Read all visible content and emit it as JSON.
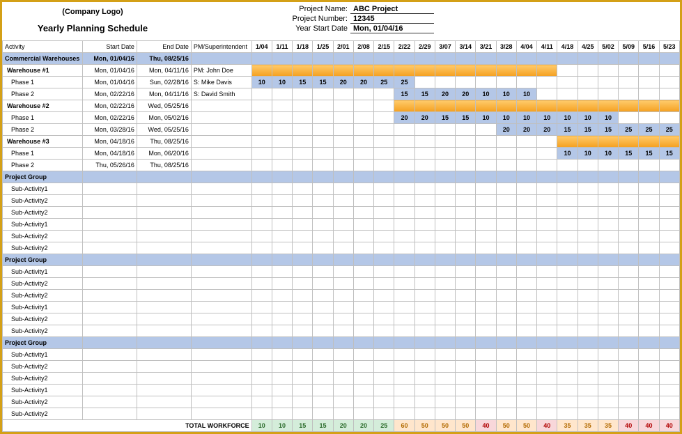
{
  "header": {
    "company_logo": "(Company Logo)",
    "title": "Yearly Planning Schedule",
    "meta": [
      {
        "label": "Project Name:",
        "value": "ABC Project"
      },
      {
        "label": "Project Number:",
        "value": "12345"
      },
      {
        "label": "Year Start Date",
        "value": "Mon, 01/04/16"
      }
    ]
  },
  "columns": {
    "activity": "Activity",
    "start": "Start Date",
    "end": "End Date",
    "pm": "PM/Superintendent"
  },
  "weeks": [
    "1/04",
    "1/11",
    "1/18",
    "1/25",
    "2/01",
    "2/08",
    "2/15",
    "2/22",
    "2/29",
    "3/07",
    "3/14",
    "3/21",
    "3/28",
    "4/04",
    "4/11",
    "4/18",
    "4/25",
    "5/02",
    "5/09",
    "5/16",
    "5/23"
  ],
  "rows": [
    {
      "type": "group",
      "activity": "Commercial Warehouses",
      "start": "Mon, 01/04/16",
      "end": "Thu, 08/25/16",
      "pm": "",
      "bar": {
        "style": "red",
        "from": 0,
        "to": 20
      }
    },
    {
      "type": "sub1",
      "activity": "Warehouse #1",
      "start": "Mon, 01/04/16",
      "end": "Mon, 04/11/16",
      "pm": "PM: John Doe",
      "bar": {
        "style": "orange",
        "from": 0,
        "to": 14
      }
    },
    {
      "type": "sub2",
      "activity": "Phase 1",
      "start": "Mon, 01/04/16",
      "end": "Sun, 02/28/16",
      "pm": "S: Mike Davis",
      "cells": {
        "0": "10",
        "1": "10",
        "2": "15",
        "3": "15",
        "4": "20",
        "5": "20",
        "6": "25",
        "7": "25"
      }
    },
    {
      "type": "sub2",
      "activity": "Phase 2",
      "start": "Mon, 02/22/16",
      "end": "Mon, 04/11/16",
      "pm": "S: David Smith",
      "cells": {
        "7": "15",
        "8": "15",
        "9": "20",
        "10": "20",
        "11": "10",
        "12": "10",
        "13": "10"
      }
    },
    {
      "type": "sub1",
      "activity": "Warehouse #2",
      "start": "Mon, 02/22/16",
      "end": "Wed, 05/25/16",
      "pm": "",
      "bar": {
        "style": "orange",
        "from": 7,
        "to": 20
      }
    },
    {
      "type": "sub2",
      "activity": "Phase 1",
      "start": "Mon, 02/22/16",
      "end": "Mon, 05/02/16",
      "pm": "",
      "cells": {
        "7": "20",
        "8": "20",
        "9": "15",
        "10": "15",
        "11": "10",
        "12": "10",
        "13": "10",
        "14": "10",
        "15": "10",
        "16": "10",
        "17": "10"
      }
    },
    {
      "type": "sub2",
      "activity": "Phase 2",
      "start": "Mon, 03/28/16",
      "end": "Wed, 05/25/16",
      "pm": "",
      "cells": {
        "12": "20",
        "13": "20",
        "14": "20",
        "15": "15",
        "16": "15",
        "17": "15",
        "18": "25",
        "19": "25",
        "20": "25"
      }
    },
    {
      "type": "sub1",
      "activity": "Warehouse #3",
      "start": "Mon, 04/18/16",
      "end": "Thu, 08/25/16",
      "pm": "",
      "bar": {
        "style": "orange",
        "from": 15,
        "to": 20
      }
    },
    {
      "type": "sub2",
      "activity": "Phase 1",
      "start": "Mon, 04/18/16",
      "end": "Mon, 06/20/16",
      "pm": "",
      "cells": {
        "15": "10",
        "16": "10",
        "17": "10",
        "18": "15",
        "19": "15",
        "20": "15"
      }
    },
    {
      "type": "sub2",
      "activity": "Phase 2",
      "start": "Thu, 05/26/16",
      "end": "Thu, 08/25/16",
      "pm": "",
      "cells": {}
    },
    {
      "type": "group",
      "activity": "Project Group",
      "start": "",
      "end": "",
      "pm": ""
    },
    {
      "type": "sub2",
      "activity": "Sub-Activity1",
      "start": "",
      "end": "",
      "pm": ""
    },
    {
      "type": "sub2",
      "activity": "Sub-Activity2",
      "start": "",
      "end": "",
      "pm": ""
    },
    {
      "type": "sub2",
      "activity": "Sub-Activity2",
      "start": "",
      "end": "",
      "pm": ""
    },
    {
      "type": "sub2",
      "activity": "Sub-Activity1",
      "start": "",
      "end": "",
      "pm": ""
    },
    {
      "type": "sub2",
      "activity": "Sub-Activity2",
      "start": "",
      "end": "",
      "pm": ""
    },
    {
      "type": "sub2",
      "activity": "Sub-Activity2",
      "start": "",
      "end": "",
      "pm": ""
    },
    {
      "type": "group",
      "activity": "Project Group",
      "start": "",
      "end": "",
      "pm": ""
    },
    {
      "type": "sub2",
      "activity": "Sub-Activity1",
      "start": "",
      "end": "",
      "pm": ""
    },
    {
      "type": "sub2",
      "activity": "Sub-Activity2",
      "start": "",
      "end": "",
      "pm": ""
    },
    {
      "type": "sub2",
      "activity": "Sub-Activity2",
      "start": "",
      "end": "",
      "pm": ""
    },
    {
      "type": "sub2",
      "activity": "Sub-Activity1",
      "start": "",
      "end": "",
      "pm": ""
    },
    {
      "type": "sub2",
      "activity": "Sub-Activity2",
      "start": "",
      "end": "",
      "pm": ""
    },
    {
      "type": "sub2",
      "activity": "Sub-Activity2",
      "start": "",
      "end": "",
      "pm": ""
    },
    {
      "type": "group",
      "activity": "Project Group",
      "start": "",
      "end": "",
      "pm": ""
    },
    {
      "type": "sub2",
      "activity": "Sub-Activity1",
      "start": "",
      "end": "",
      "pm": ""
    },
    {
      "type": "sub2",
      "activity": "Sub-Activity2",
      "start": "",
      "end": "",
      "pm": ""
    },
    {
      "type": "sub2",
      "activity": "Sub-Activity2",
      "start": "",
      "end": "",
      "pm": ""
    },
    {
      "type": "sub2",
      "activity": "Sub-Activity1",
      "start": "",
      "end": "",
      "pm": ""
    },
    {
      "type": "sub2",
      "activity": "Sub-Activity2",
      "start": "",
      "end": "",
      "pm": ""
    },
    {
      "type": "sub2",
      "activity": "Sub-Activity2",
      "start": "",
      "end": "",
      "pm": ""
    }
  ],
  "totals": {
    "label": "TOTAL WORKFORCE",
    "values": [
      {
        "v": "10",
        "c": "tg"
      },
      {
        "v": "10",
        "c": "tg"
      },
      {
        "v": "15",
        "c": "tg"
      },
      {
        "v": "15",
        "c": "tg"
      },
      {
        "v": "20",
        "c": "tg"
      },
      {
        "v": "20",
        "c": "tg"
      },
      {
        "v": "25",
        "c": "tg"
      },
      {
        "v": "60",
        "c": "to"
      },
      {
        "v": "50",
        "c": "to"
      },
      {
        "v": "50",
        "c": "to"
      },
      {
        "v": "50",
        "c": "to"
      },
      {
        "v": "40",
        "c": "tr"
      },
      {
        "v": "50",
        "c": "to"
      },
      {
        "v": "50",
        "c": "to"
      },
      {
        "v": "40",
        "c": "tr"
      },
      {
        "v": "35",
        "c": "to"
      },
      {
        "v": "35",
        "c": "to"
      },
      {
        "v": "35",
        "c": "to"
      },
      {
        "v": "40",
        "c": "tr"
      },
      {
        "v": "40",
        "c": "tr"
      },
      {
        "v": "40",
        "c": "tr"
      }
    ]
  }
}
